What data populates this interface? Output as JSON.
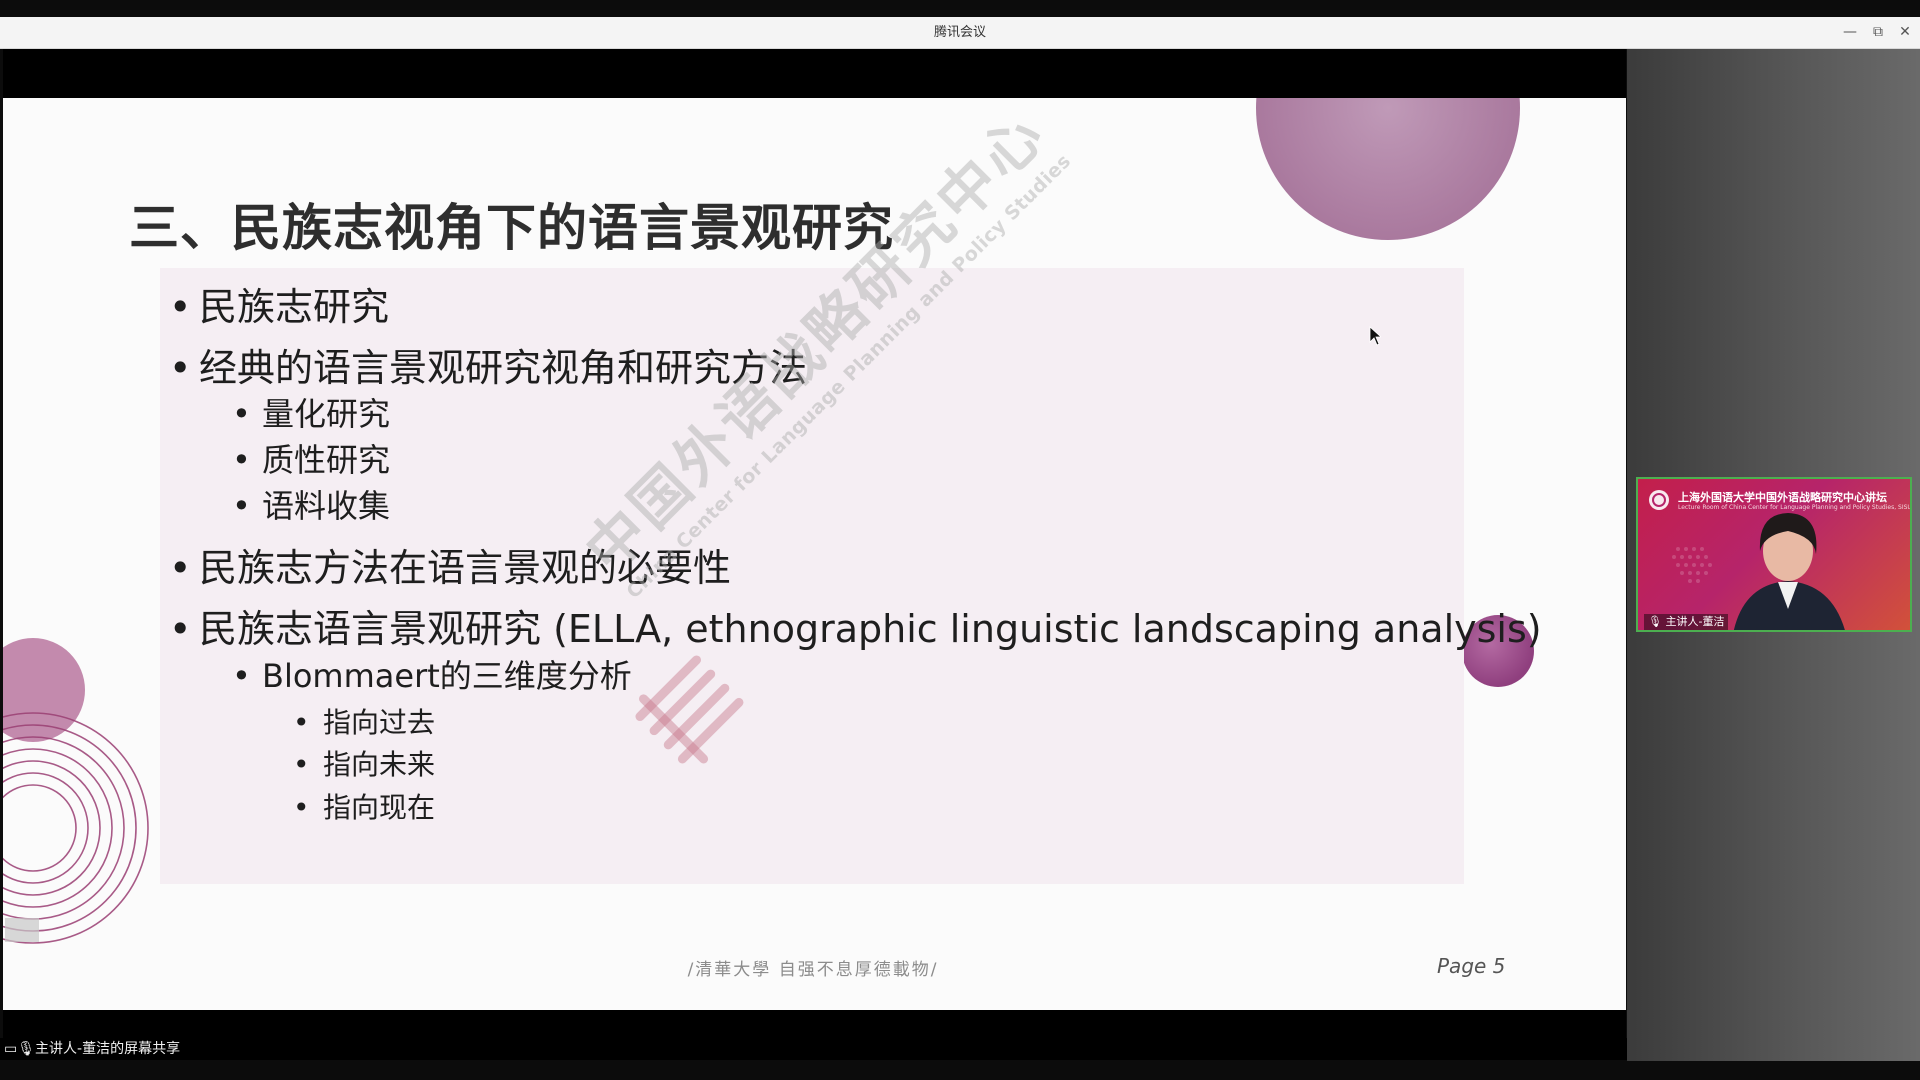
{
  "window": {
    "title": "腾讯会议",
    "controls": [
      "—",
      "⧉",
      "✕"
    ]
  },
  "slide": {
    "title": "三、民族志视角下的语言景观研究",
    "bullets": [
      {
        "level": 1,
        "text": "民族志研究"
      },
      {
        "level": 1,
        "text": "经典的语言景观研究视角和研究方法"
      },
      {
        "level": 2,
        "text": "量化研究"
      },
      {
        "level": 2,
        "text": "质性研究"
      },
      {
        "level": 2,
        "text": "语料收集"
      },
      {
        "level": 1,
        "text": "民族志方法在语言景观的必要性"
      },
      {
        "level": 1,
        "text": "民族志语言景观研究 (ELLA, ethnographic linguistic landscaping analysis)"
      },
      {
        "level": 2,
        "text": "Blommaert的三维度分析"
      },
      {
        "level": 3,
        "text": "指向过去"
      },
      {
        "level": 3,
        "text": "指向未来"
      },
      {
        "level": 3,
        "text": "指向现在"
      }
    ],
    "bullet_char": "•",
    "watermark_cn": "中国外语战略研究中心",
    "watermark_en": "China Center for Language Planning and Policy Studies",
    "footer_motto": "/清華大學 自强不息厚德載物/",
    "page_label": "Page 5"
  },
  "video": {
    "banner_title": "上海外国语大学中国外语战略研究中心讲坛",
    "banner_subtitle": "Lecture Room of China Center for Language Planning and Policy Studies, SISU",
    "speaker_label": "主讲人-董洁"
  },
  "share_label": "主讲人-董洁的屏幕共享",
  "colors": {
    "accent_purple": "#a45f93",
    "active_border": "#4caf50"
  }
}
